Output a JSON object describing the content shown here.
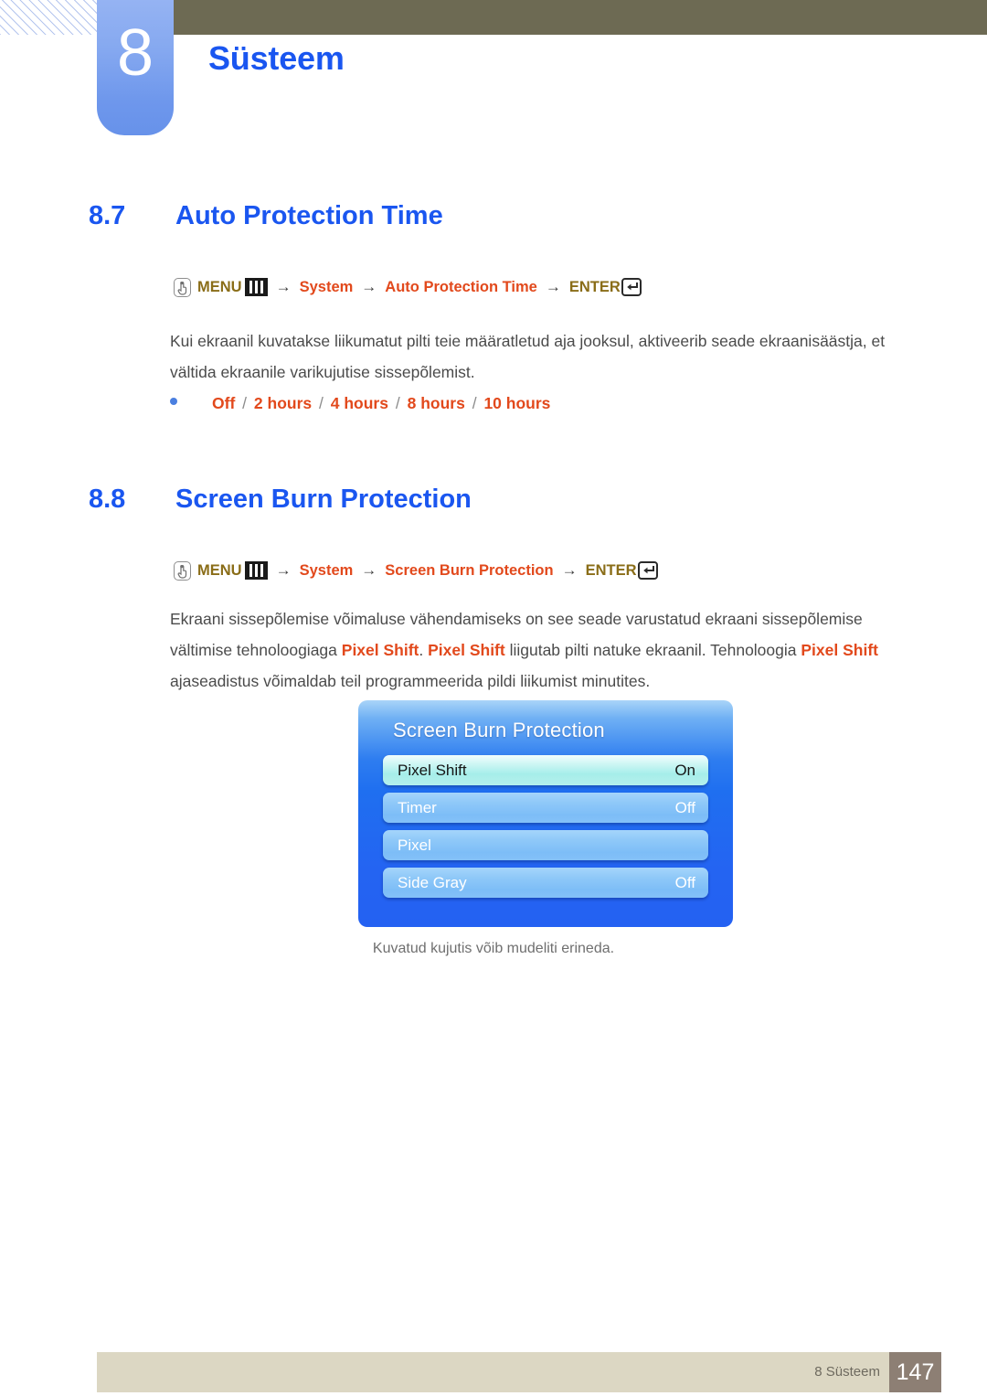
{
  "header": {
    "chapter_number": "8",
    "chapter_title": "Süsteem"
  },
  "sections": [
    {
      "number": "8.7",
      "title": "Auto Protection Time",
      "navpath": {
        "menu_label": "MENU",
        "items": [
          "System",
          "Auto Protection Time"
        ],
        "enter_label": "ENTER",
        "arrow": "→"
      },
      "paragraph": "Kui ekraanil kuvatakse liikumatut pilti teie määratletud aja jooksul, aktiveerib seade ekraanisäästja, et vältida ekraanile varikujutise sissepõlemist.",
      "options": [
        "Off",
        "2 hours",
        "4 hours",
        "8 hours",
        "10 hours"
      ],
      "option_separator": "/"
    },
    {
      "number": "8.8",
      "title": "Screen Burn Protection",
      "navpath": {
        "menu_label": "MENU",
        "items": [
          "System",
          "Screen Burn Protection"
        ],
        "enter_label": "ENTER",
        "arrow": "→"
      },
      "paragraph_parts": [
        {
          "text": "Ekraani sissepõlemise võimaluse vähendamiseks on see seade varustatud ekraani sissepõlemise vältimise tehnoloogiaga ",
          "highlight": false
        },
        {
          "text": "Pixel Shift",
          "highlight": true
        },
        {
          "text": ". ",
          "highlight": false
        },
        {
          "text": "Pixel Shift",
          "highlight": true
        },
        {
          "text": " liigutab pilti natuke ekraanil. Tehnoloogia ",
          "highlight": false
        },
        {
          "text": "Pixel Shift",
          "highlight": true
        },
        {
          "text": " ajaseadistus võimaldab teil programmeerida pildi liikumist minutites.",
          "highlight": false
        }
      ]
    }
  ],
  "osd": {
    "title": "Screen Burn Protection",
    "rows": [
      {
        "label": "Pixel Shift",
        "value": "On",
        "selected": true
      },
      {
        "label": "Timer",
        "value": "Off",
        "selected": false
      },
      {
        "label": "Pixel",
        "value": "",
        "selected": false
      },
      {
        "label": "Side Gray",
        "value": "Off",
        "selected": false
      }
    ],
    "caption": "Kuvatud kujutis võib mudeliti erineda."
  },
  "footer": {
    "label": "8 Süsteem",
    "page": "147"
  },
  "colors": {
    "heading_blue": "#1a56f0",
    "accent_orange": "#e2491c",
    "menu_gold": "#8a6d18",
    "header_bar": "#6d6a53",
    "footer_bar": "#dcd7c3",
    "footer_page_box": "#8d7f74",
    "osd_blue": "#2464f2"
  },
  "icons": {
    "hand": "hand-press-icon",
    "menu": "menu-bars-icon",
    "enter": "enter-key-icon"
  }
}
